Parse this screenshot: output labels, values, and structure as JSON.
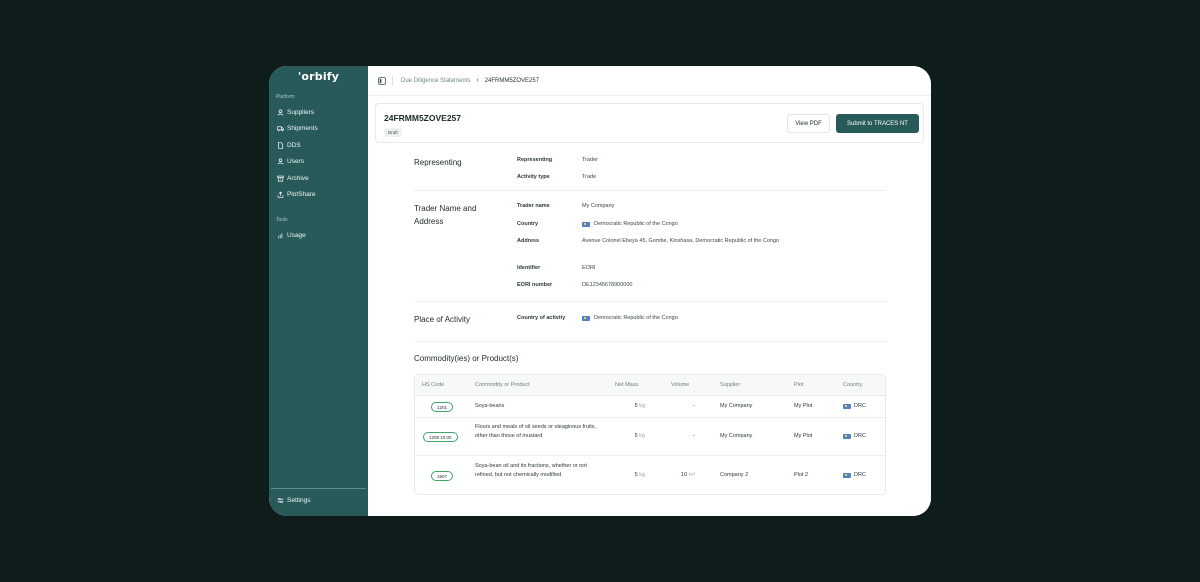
{
  "sidebar": {
    "logo": "'orbify",
    "platform_label": "Platform",
    "items": [
      {
        "label": "Suppliers",
        "icon": "user-icon"
      },
      {
        "label": "Shipments",
        "icon": "truck-icon"
      },
      {
        "label": "DDS",
        "icon": "document-icon"
      },
      {
        "label": "Users",
        "icon": "user-icon"
      },
      {
        "label": "Archive",
        "icon": "archive-icon"
      },
      {
        "label": "PlotShare",
        "icon": "share-icon"
      }
    ],
    "tools_label": "Tools",
    "tools": [
      {
        "label": "Usage",
        "icon": "chart-icon"
      }
    ],
    "settings_label": "Settings"
  },
  "breadcrumb": {
    "parent": "Due Diligence Statements",
    "current": "24FRMM5ZOVE257"
  },
  "header": {
    "title": "24FRMM5ZOVE257",
    "status": "Draft",
    "view_pdf": "View PDF",
    "submit": "Submit to TRACES NT"
  },
  "representing": {
    "title": "Representing",
    "fields": [
      {
        "label": "Representing",
        "value": "Trader"
      },
      {
        "label": "Activity type",
        "value": "Trade"
      }
    ]
  },
  "trader": {
    "title": "Trader Name and Address",
    "fields": [
      {
        "label": "Trader name",
        "value": "My Company"
      },
      {
        "label": "Country",
        "value": "Democratic Republic of the Congo"
      },
      {
        "label": "Address",
        "value": "Avenue Colonel Ebeya 45, Gombe, Kinshasa, Democratic Republic of the Congo"
      },
      {
        "label": "Identifier",
        "value": "EORI"
      },
      {
        "label": "EORI number",
        "value": "DE12345678900000"
      }
    ]
  },
  "place": {
    "title": "Place of Activity",
    "fields": [
      {
        "label": "Country of activity",
        "value": "Democratic Republic of the Congo"
      }
    ]
  },
  "commodities": {
    "title": "Commodity(ies) or Product(s)",
    "headers": [
      "HS Code",
      "Commodity or Product",
      "Net Mass",
      "Volume",
      "Supplier",
      "Plot",
      "Country"
    ],
    "rows": [
      {
        "hs": "1201",
        "product": "Soya-beans",
        "mass": "5",
        "mass_unit": "kg",
        "volume": "-",
        "volume_unit": "",
        "supplier": "My Company",
        "plot": "My Plot",
        "country": "DRC"
      },
      {
        "hs": "1208 10 00",
        "product": "Flours and meals of oil seeds or oleaginous fruits, other than those of mustard",
        "mass": "5",
        "mass_unit": "kg",
        "volume": "-",
        "volume_unit": "",
        "supplier": "My Company",
        "plot": "My Plot",
        "country": "DRC"
      },
      {
        "hs": "1507",
        "product": "Soya-bean oil and its fractions, whether or not refined, but not chemically modified",
        "mass": "5",
        "mass_unit": "kg",
        "volume": "10",
        "volume_unit": "m³",
        "supplier": "Company 2",
        "plot": "Plot 2",
        "country": "DRC"
      }
    ]
  }
}
